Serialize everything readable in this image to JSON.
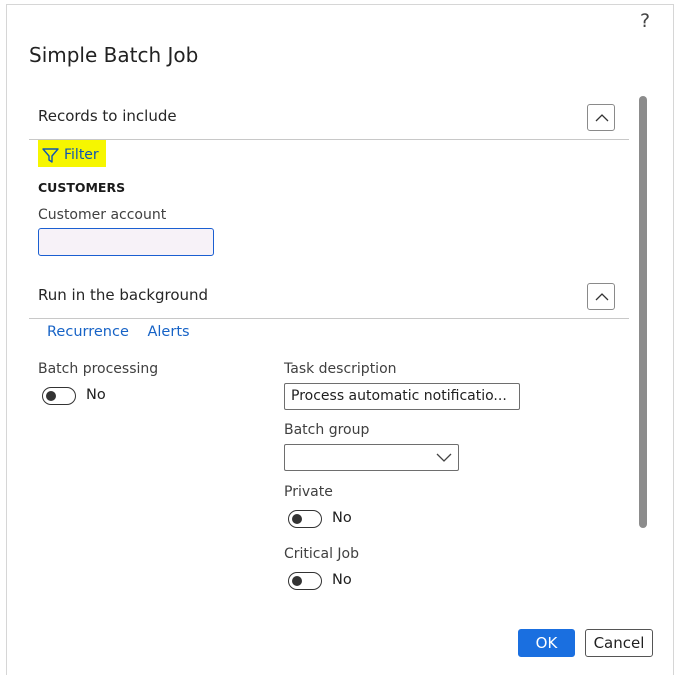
{
  "dialog": {
    "title": "Simple Batch Job",
    "help_icon": "?"
  },
  "records_section": {
    "title": "Records to include",
    "filter_label": "Filter",
    "group_label": "CUSTOMERS",
    "customer_account_label": "Customer account",
    "customer_account_value": ""
  },
  "background_section": {
    "title": "Run in the background",
    "links": [
      "Recurrence",
      "Alerts"
    ],
    "batch_processing": {
      "label": "Batch processing",
      "value": "No"
    },
    "task_description": {
      "label": "Task description",
      "value": "Process automatic notificatio..."
    },
    "batch_group": {
      "label": "Batch group",
      "value": ""
    },
    "private": {
      "label": "Private",
      "value": "No"
    },
    "critical_job": {
      "label": "Critical Job",
      "value": "No"
    }
  },
  "buttons": {
    "ok": "OK",
    "cancel": "Cancel"
  },
  "colors": {
    "accent": "#1a6fe0",
    "filter_highlight": "#f6f600",
    "link": "#1763c6"
  },
  "icons": [
    "help-icon",
    "chevron-up-icon",
    "filter-icon",
    "chevron-down-icon"
  ]
}
